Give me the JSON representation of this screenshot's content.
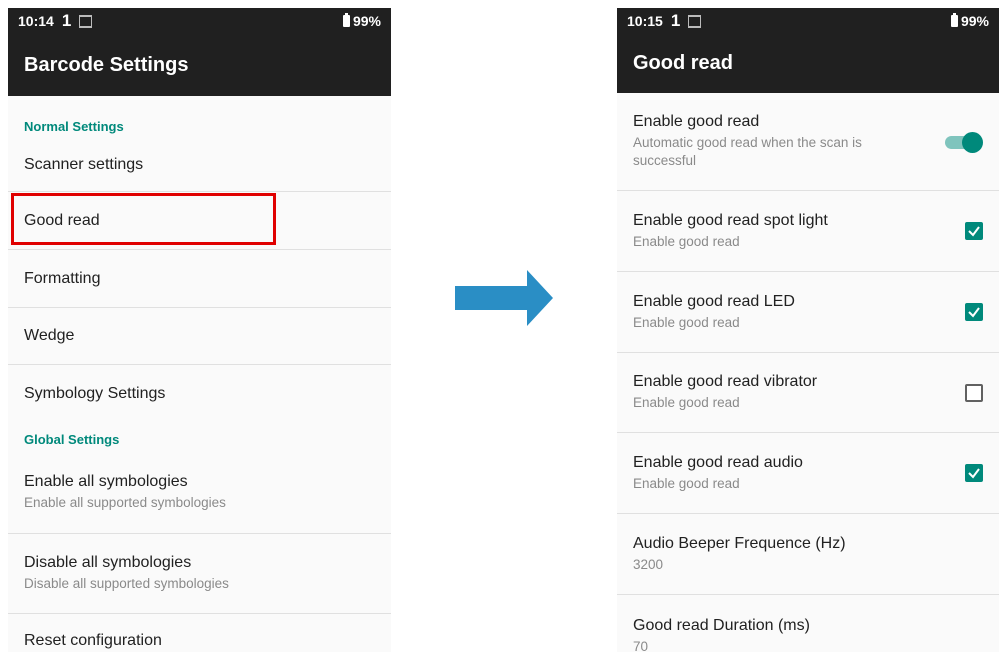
{
  "left": {
    "status": {
      "time": "10:14",
      "sim": "1",
      "battery": "99%"
    },
    "title": "Barcode Settings",
    "sections": {
      "normal": "Normal Settings",
      "global": "Global Settings"
    },
    "items": [
      {
        "title": "Scanner settings"
      },
      {
        "title": "Good read"
      },
      {
        "title": "Formatting"
      },
      {
        "title": "Wedge"
      },
      {
        "title": "Symbology Settings"
      }
    ],
    "global_items": [
      {
        "title": "Enable all symbologies",
        "summary": "Enable all supported symbologies"
      },
      {
        "title": "Disable all symbologies",
        "summary": "Disable all supported symbologies"
      },
      {
        "title": "Reset configuration"
      }
    ]
  },
  "right": {
    "status": {
      "time": "10:15",
      "sim": "1",
      "battery": "99%"
    },
    "title": "Good read",
    "items": [
      {
        "title": "Enable good read",
        "summary": "Automatic good read when the scan is successful",
        "control": "toggle",
        "checked": true
      },
      {
        "title": "Enable good read spot light",
        "summary": "Enable good read",
        "control": "checkbox",
        "checked": true
      },
      {
        "title": "Enable good read LED",
        "summary": "Enable good read",
        "control": "checkbox",
        "checked": true
      },
      {
        "title": "Enable good read vibrator",
        "summary": "Enable good read",
        "control": "checkbox",
        "checked": false
      },
      {
        "title": "Enable good read audio",
        "summary": "Enable good read",
        "control": "checkbox",
        "checked": true
      },
      {
        "title": "Audio Beeper Frequence (Hz)",
        "summary": "3200"
      },
      {
        "title": "Good read Duration (ms)",
        "summary": "70"
      }
    ]
  },
  "colors": {
    "accent": "#00897b",
    "appbar": "#202020",
    "highlight": "#e00000",
    "arrow": "#2a8ec5"
  }
}
